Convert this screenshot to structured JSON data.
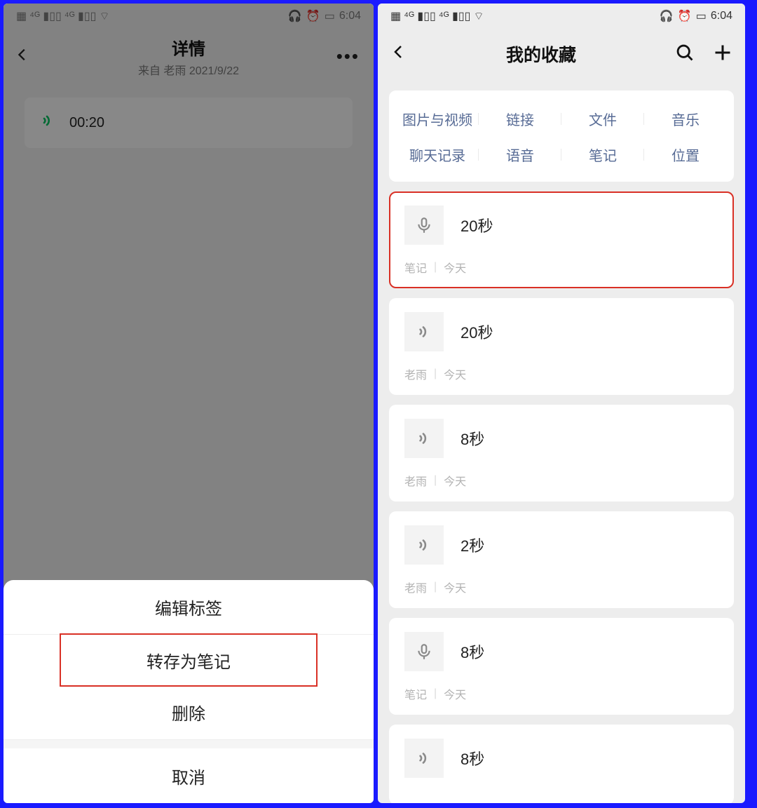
{
  "left": {
    "status": {
      "time": "6:04"
    },
    "nav": {
      "title": "详情",
      "subtitle": "来自 老雨 2021/9/22"
    },
    "voice": {
      "duration": "00:20"
    },
    "sheet": {
      "edit_label": "编辑标签",
      "save_note": "转存为笔记",
      "delete": "删除",
      "cancel": "取消"
    }
  },
  "right": {
    "status": {
      "time": "6:04"
    },
    "nav": {
      "title": "我的收藏"
    },
    "filters": {
      "row1": [
        "图片与视频",
        "链接",
        "文件",
        "音乐"
      ],
      "row2": [
        "聊天记录",
        "语音",
        "笔记",
        "位置"
      ]
    },
    "items": [
      {
        "icon": "mic",
        "title": "20秒",
        "meta_left": "笔记",
        "meta_right": "今天",
        "highlight": true
      },
      {
        "icon": "sound",
        "title": "20秒",
        "meta_left": "老雨",
        "meta_right": "今天",
        "highlight": false
      },
      {
        "icon": "sound",
        "title": "8秒",
        "meta_left": "老雨",
        "meta_right": "今天",
        "highlight": false
      },
      {
        "icon": "sound",
        "title": "2秒",
        "meta_left": "老雨",
        "meta_right": "今天",
        "highlight": false
      },
      {
        "icon": "mic",
        "title": "8秒",
        "meta_left": "笔记",
        "meta_right": "今天",
        "highlight": false
      },
      {
        "icon": "sound",
        "title": "8秒",
        "meta_left": "",
        "meta_right": "",
        "highlight": false
      }
    ]
  }
}
